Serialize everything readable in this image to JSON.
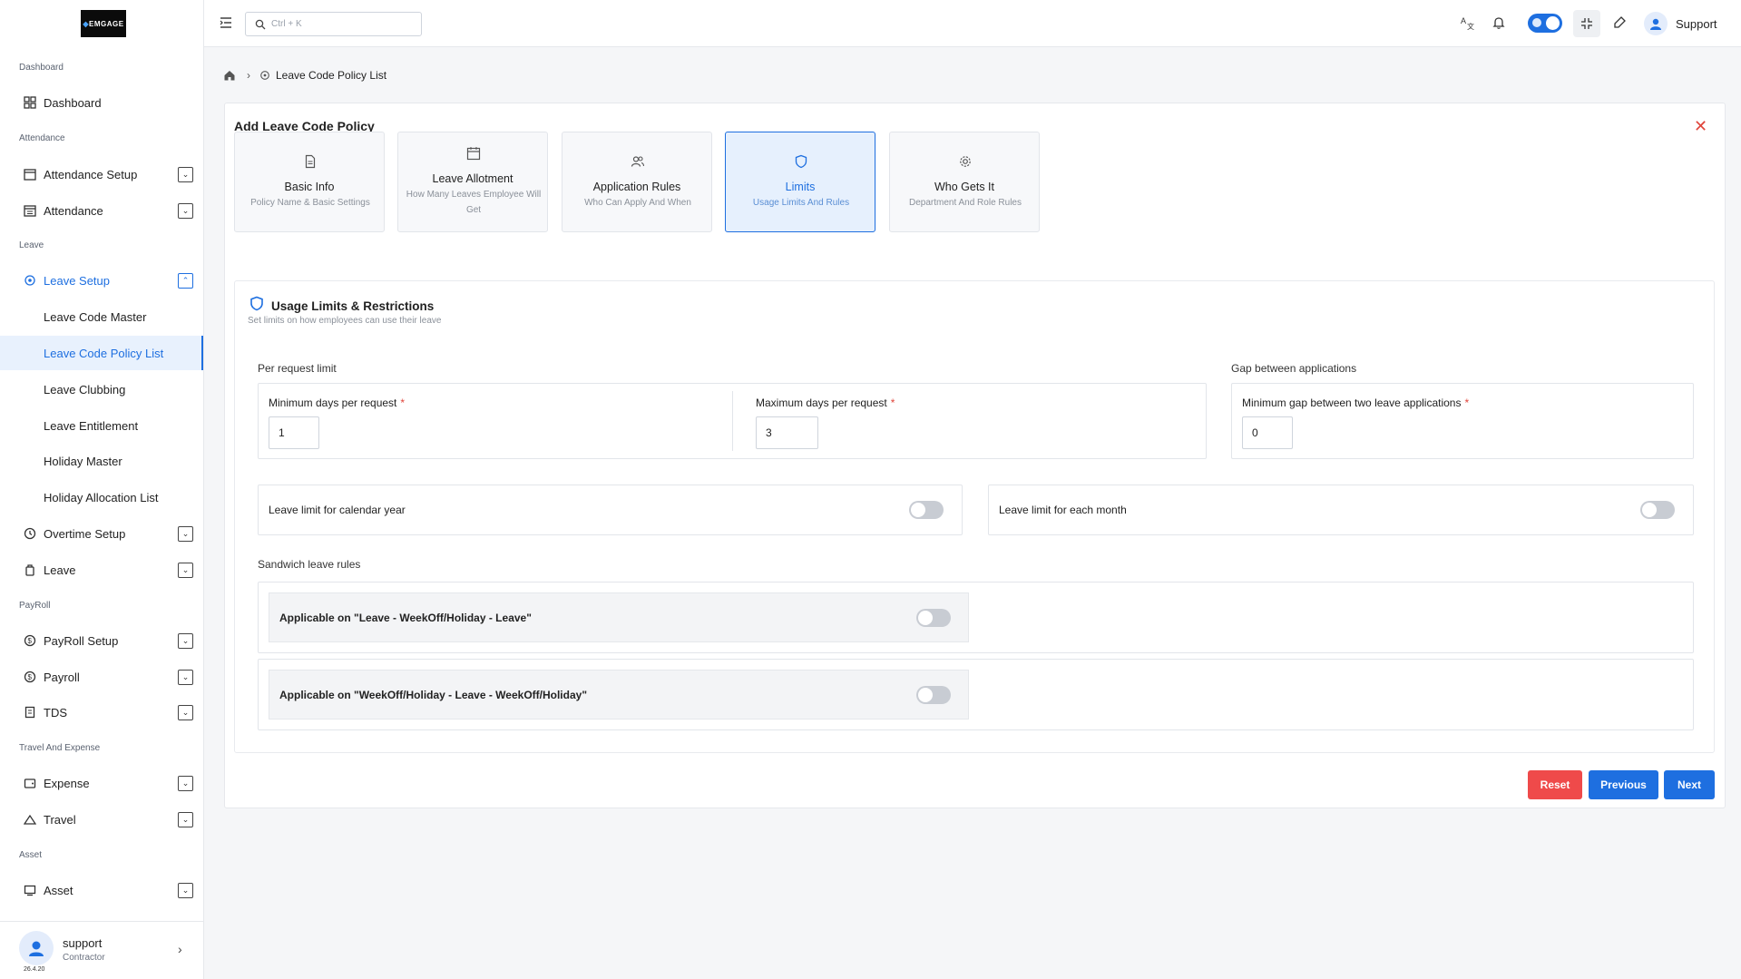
{
  "app": {
    "logo_text": "EMGAGE"
  },
  "sidebar": {
    "sections": [
      {
        "label": "Dashboard"
      },
      {
        "label": "Attendance"
      },
      {
        "label": "Leave"
      },
      {
        "label": "PayRoll"
      },
      {
        "label": "Travel And Expense"
      },
      {
        "label": "Asset"
      }
    ],
    "items": {
      "dashboard": "Dashboard",
      "attendance_setup": "Attendance Setup",
      "attendance": "Attendance",
      "leave_setup": "Leave Setup",
      "leave_code_master": "Leave Code Master",
      "leave_code_policy_list": "Leave Code Policy List",
      "leave_clubbing": "Leave Clubbing",
      "leave_entitlement": "Leave Entitlement",
      "holiday_master": "Holiday Master",
      "holiday_allocation_list": "Holiday Allocation List",
      "overtime_setup": "Overtime Setup",
      "leave": "Leave",
      "payroll_setup": "PayRoll Setup",
      "payroll": "Payroll",
      "tds": "TDS",
      "expense": "Expense",
      "travel": "Travel",
      "asset": "Asset"
    },
    "user": {
      "name": "support",
      "role": "Contractor",
      "version": "26.4.20"
    }
  },
  "topbar": {
    "search_placeholder": "Ctrl + K",
    "user_name": "Support"
  },
  "breadcrumb": {
    "current": "Leave Code Policy List"
  },
  "form": {
    "title": "Add Leave Code Policy",
    "steps": [
      {
        "title": "Basic Info",
        "subtitle": "Policy Name & Basic Settings",
        "icon": "document-icon"
      },
      {
        "title": "Leave Allotment",
        "subtitle": "How Many Leaves Employee Will Get",
        "icon": "calendar-icon"
      },
      {
        "title": "Application Rules",
        "subtitle": "Who Can Apply And When",
        "icon": "users-icon"
      },
      {
        "title": "Limits",
        "subtitle": "Usage Limits And Rules",
        "icon": "shield-icon"
      },
      {
        "title": "Who Gets It",
        "subtitle": "Department And Role Rules",
        "icon": "gear-icon"
      }
    ],
    "active_step": 3,
    "section": {
      "title": "Usage Limits & Restrictions",
      "subtitle": "Set limits on how employees can use their leave"
    },
    "per_request": {
      "label": "Per request limit",
      "min_label": "Minimum days per request",
      "min_value": "1",
      "max_label": "Maximum days per request",
      "max_value": "3"
    },
    "gap": {
      "label": "Gap between applications",
      "min_gap_label": "Minimum gap between two leave applications",
      "min_gap_value": "0"
    },
    "toggles": {
      "calendar_year": "Leave limit for calendar year",
      "each_month": "Leave limit for each month"
    },
    "sandwich": {
      "label": "Sandwich leave rules",
      "rule1": "Applicable on \"Leave - WeekOff/Holiday - Leave\"",
      "rule2": "Applicable on \"WeekOff/Holiday - Leave - WeekOff/Holiday\""
    },
    "buttons": {
      "reset": "Reset",
      "previous": "Previous",
      "next": "Next"
    }
  },
  "colors": {
    "accent": "#1e6fe0",
    "danger": "#ef4a4a",
    "required": "#e0453b"
  }
}
